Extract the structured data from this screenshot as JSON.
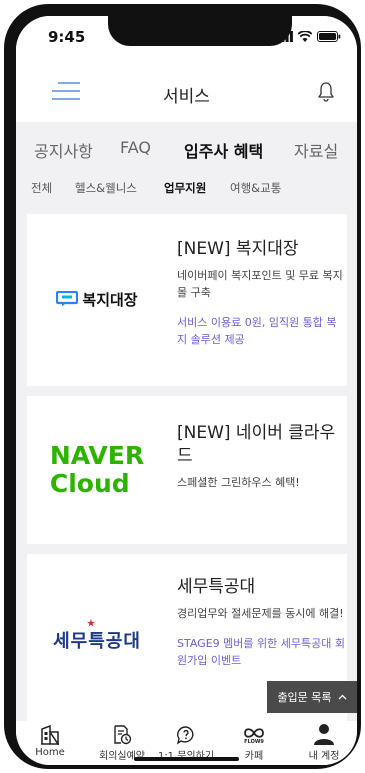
{
  "status_bar": {
    "time": "9:45"
  },
  "header": {
    "title": "서비스"
  },
  "tabs": [
    {
      "label": "공지사항",
      "active": false
    },
    {
      "label": "FAQ",
      "active": false
    },
    {
      "label": "입주사 혜택",
      "active": true
    },
    {
      "label": "자료실",
      "active": false
    }
  ],
  "subtabs": [
    {
      "label": "전체",
      "active": false
    },
    {
      "label": "헬스&웰니스",
      "active": false
    },
    {
      "label": "업무지원",
      "active": true
    },
    {
      "label": "여행&교통",
      "active": false
    }
  ],
  "cards": [
    {
      "logo_text": "복지대장",
      "title": "[NEW] 복지대장",
      "description": "네이버페이 복지포인트 및 무료 복지몰 구축",
      "promo": "서비스 이용료 0원, 임직원 통합 복지 솔루션 제공"
    },
    {
      "logo_line1": "NAVER",
      "logo_line2": "Cloud",
      "title": "[NEW] 네이버 클라우드",
      "description": "스페셜한 그린하우스 혜택!"
    },
    {
      "logo_text": "세무특공대",
      "title": "세무특공대",
      "description": "경리업무와 절세문제를 동시에 해결!",
      "promo": "STAGE9 멤버를 위한 세무특공대 회원가입 이벤트"
    }
  ],
  "floating_button": {
    "label": "출입문 목록",
    "icon": "chevron-up-icon"
  },
  "bottom_nav": [
    {
      "label": "Home",
      "icon": "building-icon"
    },
    {
      "label": "회의실예약",
      "icon": "document-clock-icon"
    },
    {
      "label": "1:1 문의하기",
      "icon": "chat-question-icon"
    },
    {
      "label": "카페",
      "icon": "flow9-icon",
      "icon_text": "FLOW9"
    },
    {
      "label": "내 계정",
      "icon": "person-icon"
    }
  ],
  "colors": {
    "accent_purple": "#6b5fd6",
    "naver_green": "#2db400",
    "logo_blue": "#1d3a8a"
  }
}
